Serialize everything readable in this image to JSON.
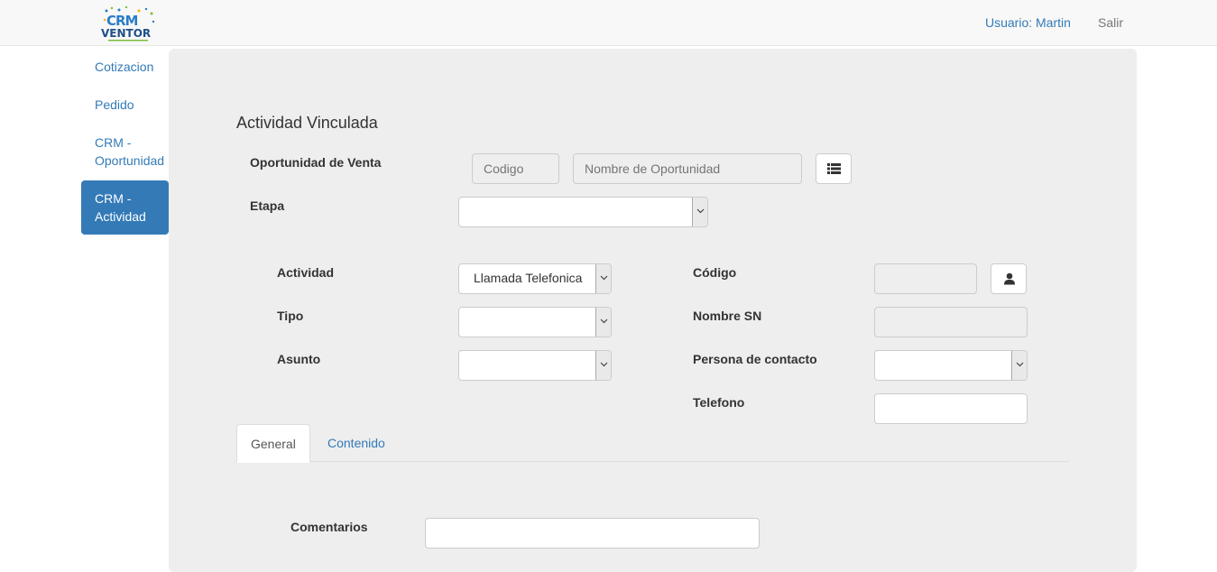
{
  "header": {
    "logo_text_top": "CRM",
    "logo_text_bottom": "VENTOR",
    "user_label": "Usuario: Martin",
    "logout_label": "Salir"
  },
  "sidebar": {
    "items": [
      {
        "label": "Cotizacion"
      },
      {
        "label": "Pedido"
      },
      {
        "label": "CRM - Oportunidad"
      },
      {
        "label": "CRM - Actividad"
      }
    ]
  },
  "form": {
    "section_title": "Actividad Vinculada",
    "oportunidad_label": "Oportunidad de Venta",
    "codigo_placeholder": "Codigo",
    "nombre_oportunidad_placeholder": "Nombre de Oportunidad",
    "etapa_label": "Etapa",
    "etapa_value": "",
    "actividad_label": "Actividad",
    "actividad_value": "Llamada Telefonica",
    "tipo_label": "Tipo",
    "tipo_value": "",
    "asunto_label": "Asunto",
    "asunto_value": "",
    "codigo_sn_label": "Código",
    "codigo_sn_value": "",
    "nombre_sn_label": "Nombre SN",
    "nombre_sn_value": "",
    "persona_contacto_label": "Persona de contacto",
    "persona_contacto_value": "",
    "telefono_label": "Telefono",
    "telefono_value": ""
  },
  "tabs": [
    {
      "label": "General",
      "active": true
    },
    {
      "label": "Contenido",
      "active": false
    }
  ],
  "general": {
    "comentarios_label": "Comentarios",
    "comentarios_value": ""
  },
  "colors": {
    "accent": "#337ab7",
    "panel_bg": "#eeeeee"
  }
}
